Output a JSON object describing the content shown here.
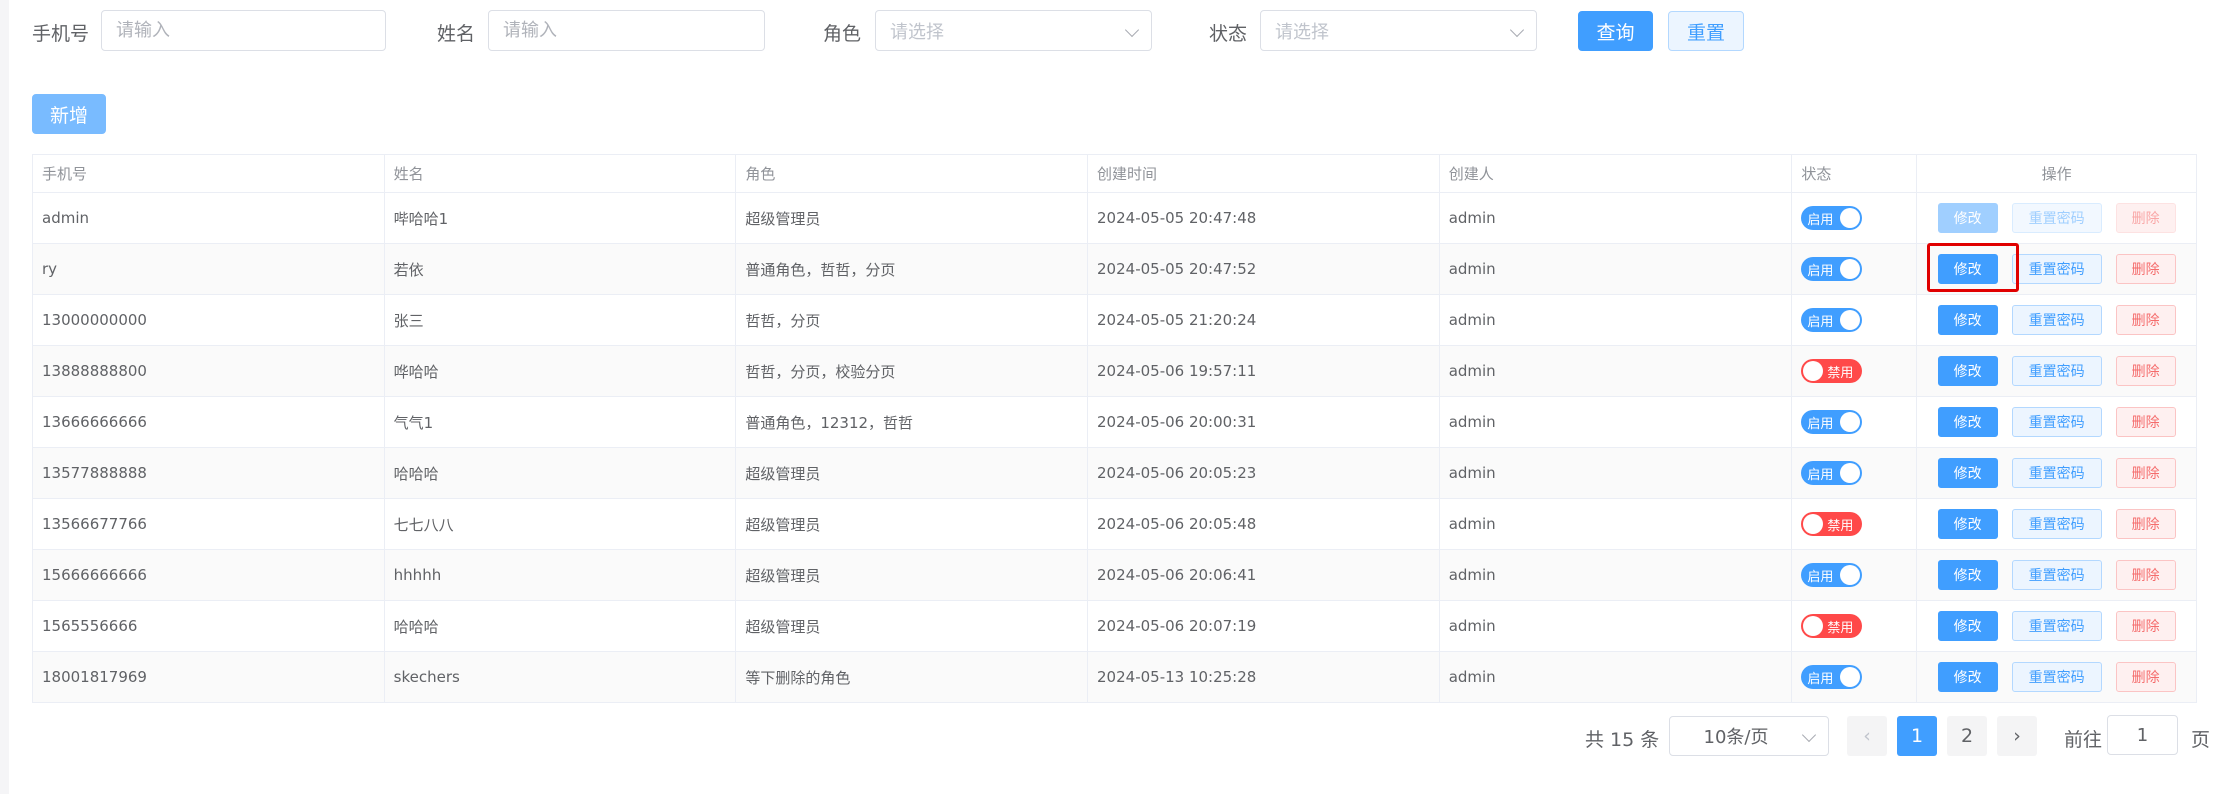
{
  "search": {
    "phone_label": "手机号",
    "phone_placeholder": "请输入",
    "name_label": "姓名",
    "name_placeholder": "请输入",
    "role_label": "角色",
    "role_placeholder": "请选择",
    "status_label": "状态",
    "status_placeholder": "请选择",
    "query_label": "查询",
    "reset_label": "重置"
  },
  "toolbar": {
    "add_label": "新增"
  },
  "table": {
    "headers": [
      "手机号",
      "姓名",
      "角色",
      "创建时间",
      "创建人",
      "状态",
      "操作"
    ],
    "actions": {
      "edit": "修改",
      "reset_pwd": "重置密码",
      "delete": "删除"
    },
    "rows": [
      {
        "phone": "admin",
        "name": "哔哈哈1",
        "role": "超级管理员",
        "created": "2024-05-05 20:47:48",
        "creator": "admin",
        "status": "启用",
        "enabled": true
      },
      {
        "phone": "ry",
        "name": "若依",
        "role": "普通角色，哲哲，分页",
        "created": "2024-05-05 20:47:52",
        "creator": "admin",
        "status": "启用",
        "enabled": true
      },
      {
        "phone": "13000000000",
        "name": "张三",
        "role": "哲哲，分页",
        "created": "2024-05-05 21:20:24",
        "creator": "admin",
        "status": "启用",
        "enabled": true
      },
      {
        "phone": "13888888800",
        "name": "哗哈哈",
        "role": "哲哲，分页，校验分页",
        "created": "2024-05-06 19:57:11",
        "creator": "admin",
        "status": "禁用",
        "enabled": false
      },
      {
        "phone": "13666666666",
        "name": "气气1",
        "role": "普通角色，12312，哲哲",
        "created": "2024-05-06 20:00:31",
        "creator": "admin",
        "status": "启用",
        "enabled": true
      },
      {
        "phone": "13577888888",
        "name": "哈哈哈",
        "role": "超级管理员",
        "created": "2024-05-06 20:05:23",
        "creator": "admin",
        "status": "启用",
        "enabled": true
      },
      {
        "phone": "13566677766",
        "name": "七七八八",
        "role": "超级管理员",
        "created": "2024-05-06 20:05:48",
        "creator": "admin",
        "status": "禁用",
        "enabled": false
      },
      {
        "phone": "15666666666",
        "name": "hhhhh",
        "role": "超级管理员",
        "created": "2024-05-06 20:06:41",
        "creator": "admin",
        "status": "启用",
        "enabled": true
      },
      {
        "phone": "1565556666",
        "name": "哈哈哈",
        "role": "超级管理员",
        "created": "2024-05-06 20:07:19",
        "creator": "admin",
        "status": "禁用",
        "enabled": false
      },
      {
        "phone": "18001817969",
        "name": "skechers",
        "role": "等下删除的角色",
        "created": "2024-05-13 10:25:28",
        "creator": "admin",
        "status": "启用",
        "enabled": true
      }
    ]
  },
  "pagination": {
    "total_text": "共 15 条",
    "page_size": "10条/页",
    "pages": [
      "1",
      "2"
    ],
    "current_page": "1",
    "goto_label": "前往",
    "goto_value": "1",
    "goto_unit": "页",
    "prev_icon": "‹",
    "next_icon": "›"
  },
  "colors": {
    "primary": "#409eff",
    "danger": "#ff4949",
    "highlight": "#e00000"
  }
}
